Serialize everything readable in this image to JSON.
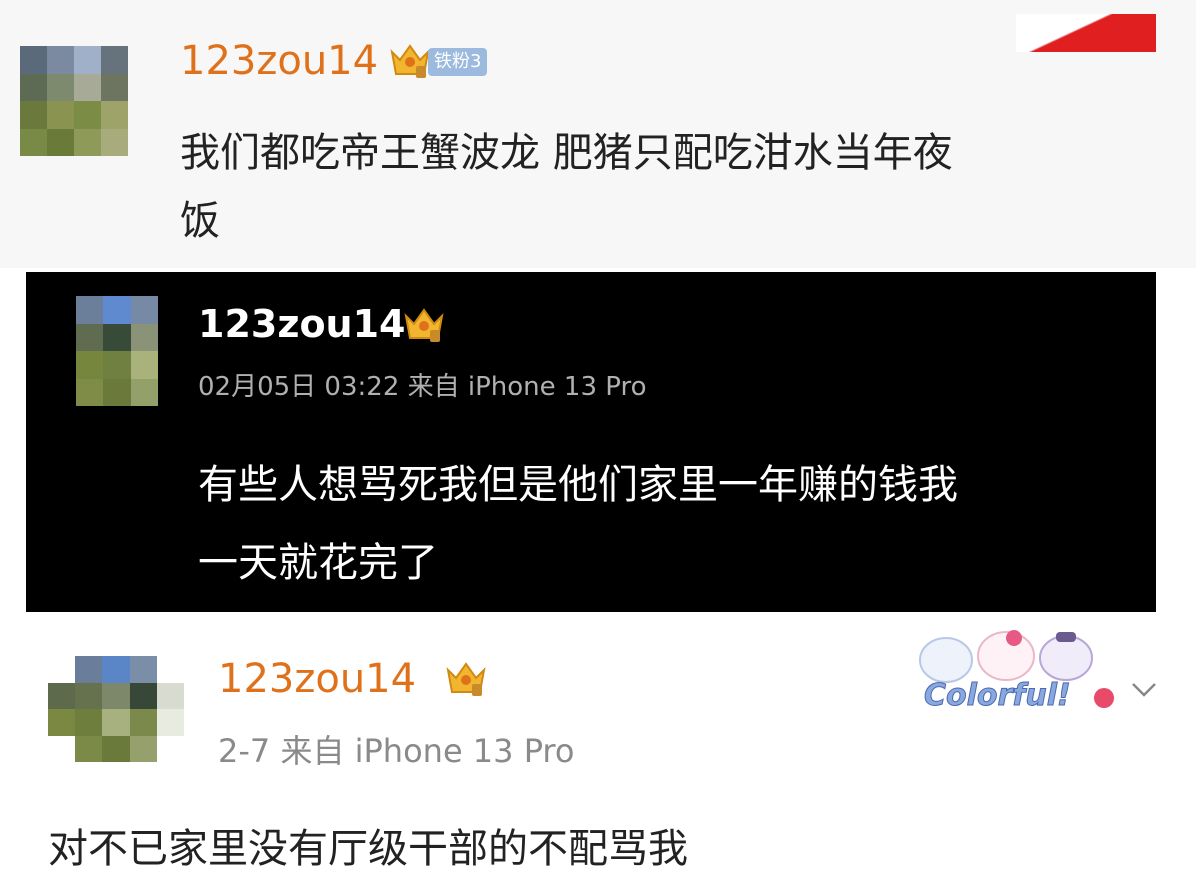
{
  "comment1": {
    "username": "123zou14",
    "fan_badge": "铁粉3",
    "text_line1": "我们都吃帝王蟹波龙 肥猪只配吃泔水当年夜",
    "text_line2": "饭",
    "username_color": "#e0711b"
  },
  "comment2": {
    "username": "123zou14",
    "meta": "02月05日 03:22  来自 iPhone 13 Pro",
    "text_line1": "有些人想骂死我但是他们家里一年赚的钱我",
    "text_line2": "一天就花完了"
  },
  "comment3": {
    "username": "123zou14",
    "meta": "2-7  来自 iPhone 13 Pro",
    "text_line1": "对不已家里没有厅级干部的不配骂我",
    "sticker_label": "Colorful!",
    "username_color": "#e0711b"
  },
  "icons": {
    "crown": "crown-vip-icon",
    "chevron": "chevron-down-icon"
  }
}
